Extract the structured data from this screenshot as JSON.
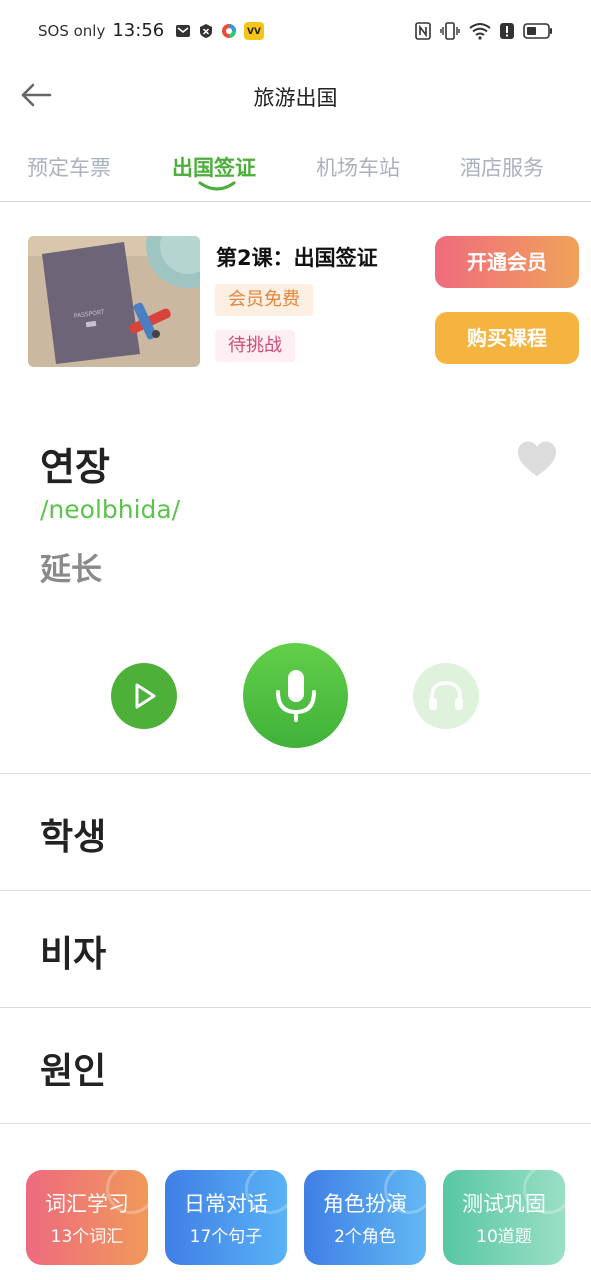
{
  "status_bar": {
    "carrier": "SOS only",
    "time": "13:56"
  },
  "header": {
    "title": "旅游出国"
  },
  "tabs": [
    {
      "label": "预定车票"
    },
    {
      "label": "出国签证"
    },
    {
      "label": "机场车站"
    },
    {
      "label": "酒店服务"
    }
  ],
  "lesson": {
    "title": "第2课：出国签证",
    "badge_free": "会员免费",
    "badge_challenge": "待挑战",
    "vip_button": "开通会员",
    "buy_button": "购买课程"
  },
  "current_word": {
    "word": "연장",
    "phonetic": "/neolbhida/",
    "meaning": "延长"
  },
  "word_list": [
    "학생",
    "비자",
    "원인"
  ],
  "cards": [
    {
      "title": "词汇学习",
      "sub": "13个词汇"
    },
    {
      "title": "日常对话",
      "sub": "17个句子"
    },
    {
      "title": "角色扮演",
      "sub": "2个角色"
    },
    {
      "title": "测试巩固",
      "sub": "10道题"
    }
  ],
  "colors": {
    "accent_green": "#4caf3c",
    "phonetic_green": "#5ec24e",
    "vip_orange": "#f0a25a",
    "buy_yellow": "#f4b43f"
  }
}
